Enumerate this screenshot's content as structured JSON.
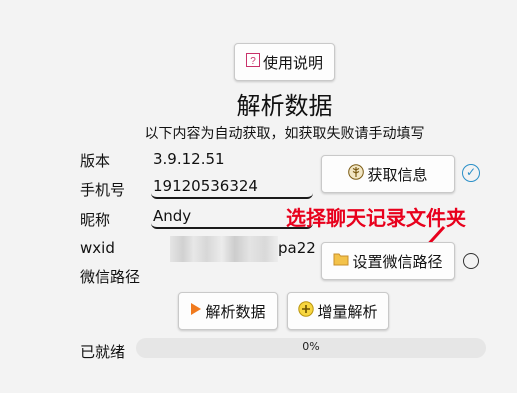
{
  "help_button": {
    "label": "使用说明"
  },
  "title": "解析数据",
  "subtitle": "以下内容为自动获取，如获取失败请手动填写",
  "fields": {
    "version": {
      "label": "版本",
      "value": "3.9.12.51"
    },
    "phone": {
      "label": "手机号",
      "value": "19120536324"
    },
    "nickname": {
      "label": "昵称",
      "value": "Andy"
    },
    "wxid": {
      "label": "wxid",
      "value_suffix": "pa22"
    },
    "wechat_path": {
      "label": "微信路径"
    }
  },
  "get_info_button": {
    "label": "获取信息"
  },
  "set_path_button": {
    "label": "设置微信路径"
  },
  "annotation": {
    "text": "选择聊天记录文件夹",
    "color": "#e8001c"
  },
  "parse_button": {
    "label": "解析数据"
  },
  "incremental_button": {
    "label": "增量解析"
  },
  "status": {
    "label": "已就绪",
    "progress_text": "0%",
    "progress": 0
  }
}
